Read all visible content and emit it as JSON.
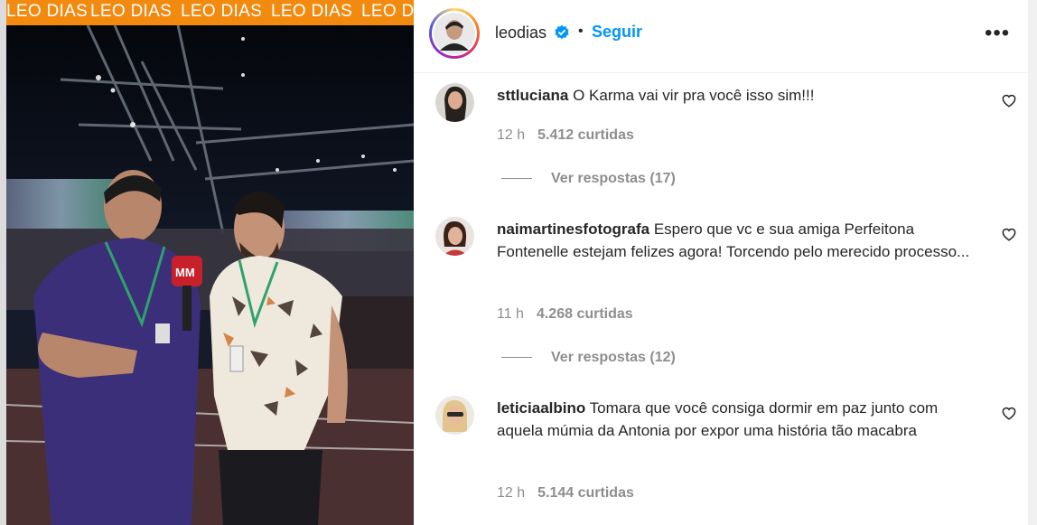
{
  "media": {
    "watermark": "LEO DIAS",
    "microphone_logo": "MM"
  },
  "post": {
    "author": "leodias",
    "verified_icon": "verified-badge-icon",
    "separator": "•",
    "follow_label": "Seguir",
    "more_icon": "more-options-icon",
    "more_label": "•••"
  },
  "comments": [
    {
      "username": "sttluciana",
      "text": "O Karma vai vir pra você isso sim!!!",
      "time": "12 h",
      "likes": "5.412 curtidas",
      "replies": "Ver respostas (17)"
    },
    {
      "username": "naimartinesfotografa",
      "text": "Espero que vc e sua amiga Perfeitona Fontenelle estejam felizes agora! Torcendo pelo merecido processo...",
      "time": "11 h",
      "likes": "4.268 curtidas",
      "replies": "Ver respostas (12)"
    },
    {
      "username": "leticiaalbino",
      "text": "Tomara que você consiga dormir em paz junto com aquela múmia da Antonia por expor uma história tão macabra",
      "time": "12 h",
      "likes": "5.144 curtidas"
    }
  ],
  "colors": {
    "accent": "#0095f6",
    "watermark_bar": "#f28a10",
    "muted": "#8e8e8e"
  }
}
